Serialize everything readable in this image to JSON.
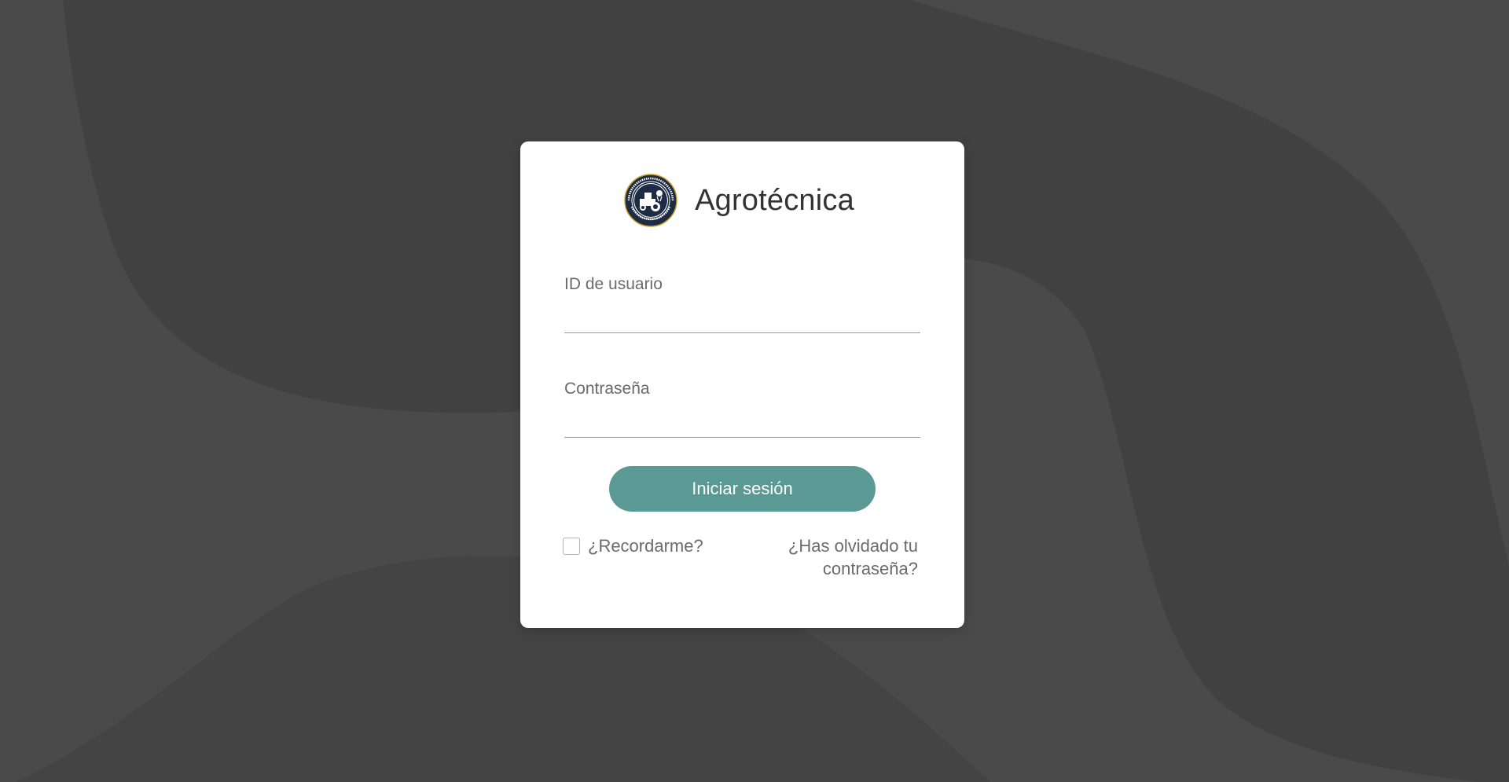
{
  "page": {
    "background_color": "#4a4a4a",
    "background_dark_shape_color": "#404040",
    "accent_color": "#5b9a94"
  },
  "brand": {
    "name": "Agrotécnica",
    "logo_icon": "school-seal-logo"
  },
  "form": {
    "user_label": "ID de usuario",
    "user_value": "",
    "password_label": "Contraseña",
    "password_value": "",
    "submit_label": "Iniciar sesión",
    "remember_label": "¿Recordarme?",
    "remember_checked": false,
    "forgot_label": "¿Has olvidado tu contraseña?"
  }
}
